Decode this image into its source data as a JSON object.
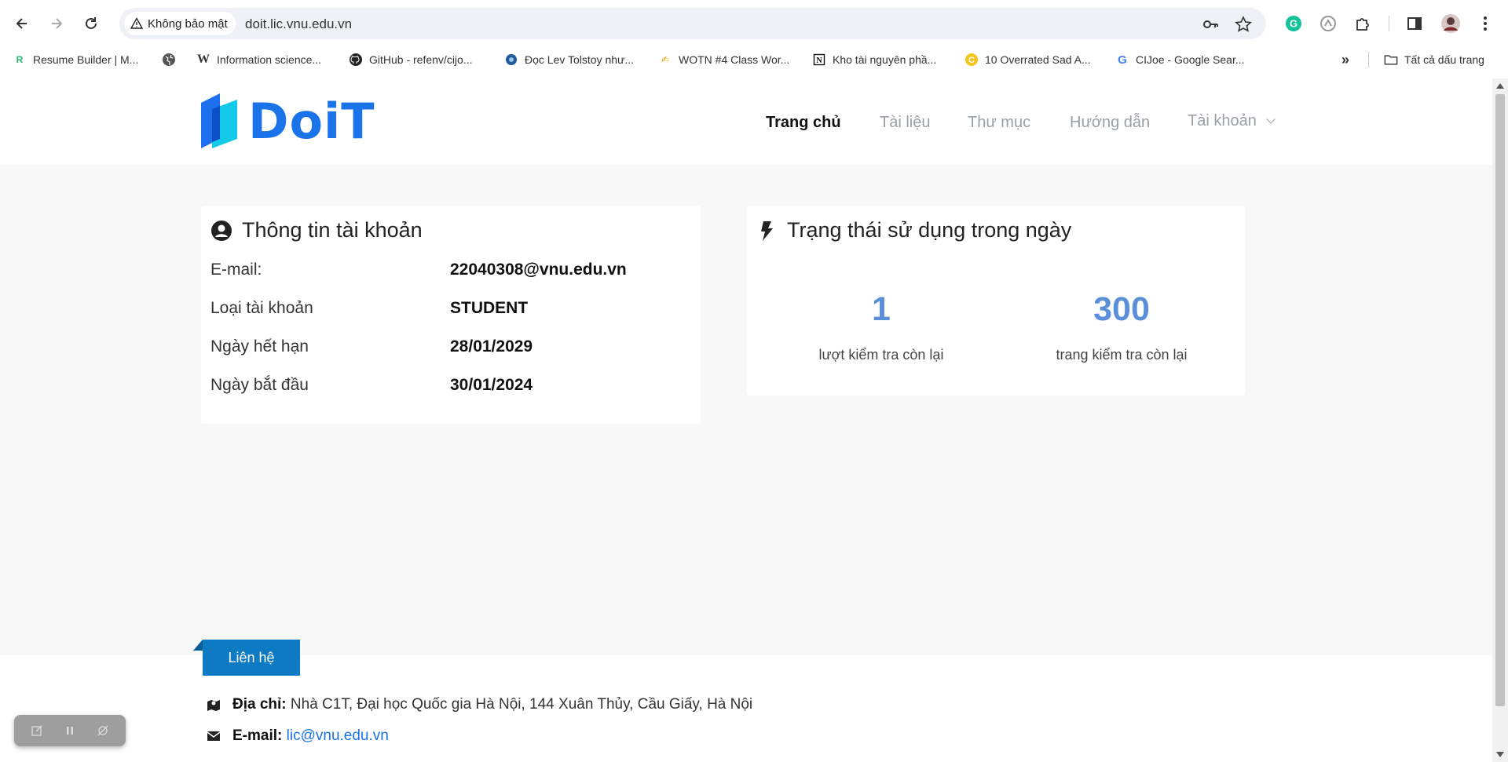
{
  "browser": {
    "security_label": "Không bảo mật",
    "url": "doit.lic.vnu.edu.vn",
    "bookmarks": [
      {
        "label": "Resume Builder | M...",
        "icon": "resume-builder-favicon"
      },
      {
        "label": "",
        "icon": "globe-icon"
      },
      {
        "label": "Information science...",
        "icon": "wikipedia-icon"
      },
      {
        "label": "GitHub - refenv/cijo...",
        "icon": "github-icon"
      },
      {
        "label": "Đọc Lev Tolstoy như...",
        "icon": "site-favicon"
      },
      {
        "label": "WOTN #4 Class Wor...",
        "icon": "pen-icon"
      },
      {
        "label": "Kho tài nguyên phầ...",
        "icon": "notion-icon"
      },
      {
        "label": "10 Overrated Sad A...",
        "icon": "c-favicon"
      },
      {
        "label": "CIJoe - Google Sear...",
        "icon": "google-icon"
      }
    ],
    "all_bookmarks_label": "Tất cả dấu trang"
  },
  "site": {
    "logo_text": "DoiT",
    "nav": [
      {
        "label": "Trang chủ",
        "active": true
      },
      {
        "label": "Tài liệu",
        "active": false
      },
      {
        "label": "Thư mục",
        "active": false
      },
      {
        "label": "Hướng dẫn",
        "active": false
      },
      {
        "label": "Tài khoản",
        "active": false
      }
    ]
  },
  "account": {
    "title": "Thông tin tài khoản",
    "rows": [
      {
        "label": "E-mail:",
        "value": "22040308@vnu.edu.vn"
      },
      {
        "label": "Loại tài khoản",
        "value": "STUDENT"
      },
      {
        "label": "Ngày hết hạn",
        "value": "28/01/2029"
      },
      {
        "label": "Ngày bắt đầu",
        "value": "30/01/2024"
      }
    ]
  },
  "usage": {
    "title": "Trạng thái sử dụng trong ngày",
    "stats": [
      {
        "value": "1",
        "label": "lượt kiểm tra còn lại"
      },
      {
        "value": "300",
        "label": "trang kiểm tra còn lại"
      }
    ]
  },
  "footer": {
    "contact_tab": "Liên hệ",
    "address_label": "Địa chỉ:",
    "address": "Nhà C1T, Đại học Quốc gia Hà Nội, 144 Xuân Thủy, Cầu Giấy, Hà Nội",
    "email_label": "E-mail:",
    "email": "lic@vnu.edu.vn"
  },
  "colors": {
    "accent": "#1a73e8",
    "stat": "#5b8fd9",
    "contact_tab": "#0e7ac4"
  }
}
